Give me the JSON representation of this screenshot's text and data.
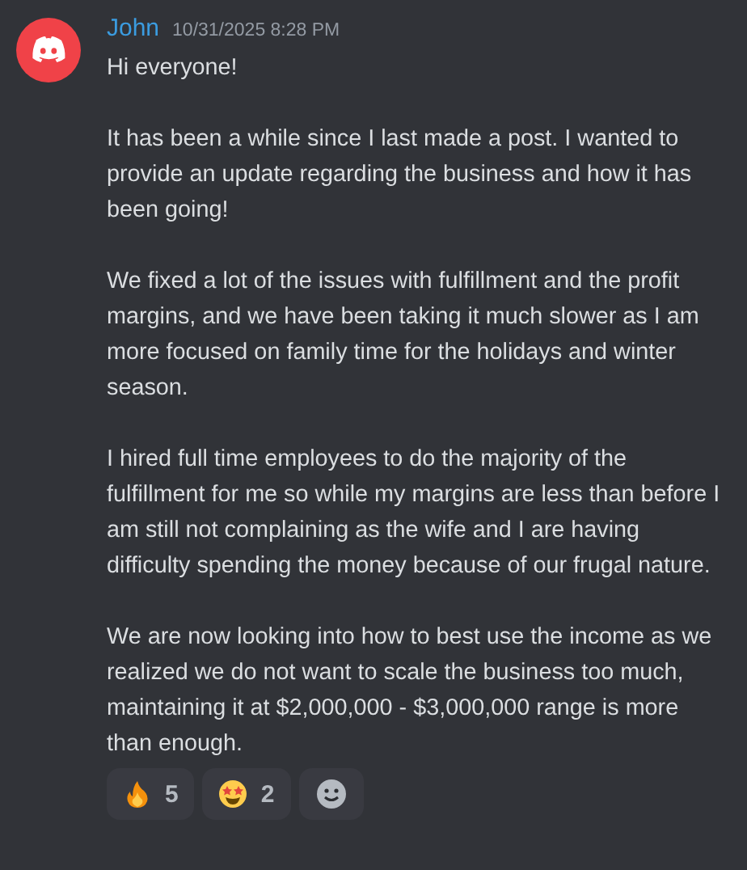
{
  "message": {
    "author": "John",
    "timestamp": "10/31/2025 8:28 PM",
    "paragraphs": [
      "Hi everyone!",
      "It has been a while since I last made a post. I wanted to provide an update regarding the business and how it has been going!",
      "We fixed a lot of the issues with fulfillment and the profit margins, and we have been taking it much slower as I am more focused on family time for the holidays and winter season.",
      "I hired full time employees to do the majority of the fulfillment for me so while my margins are less than before I am still not complaining as the wife and I are having difficulty spending the money because of our frugal nature.",
      "We are now looking into how to best use the income as we realized we do not want to scale the business too much, maintaining it at $2,000,000 - $3,000,000 range is more than enough."
    ],
    "reactions": [
      {
        "kind": "fire",
        "count": "5"
      },
      {
        "kind": "star-struck",
        "count": "2"
      },
      {
        "kind": "add"
      }
    ]
  }
}
